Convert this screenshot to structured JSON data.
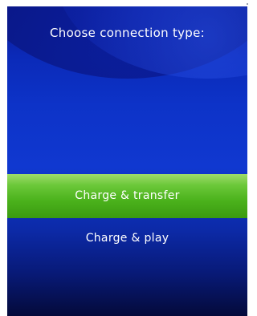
{
  "dialog": {
    "title": "Choose connection type:"
  },
  "options": [
    {
      "label": "Charge & transfer",
      "selected": true
    },
    {
      "label": "Charge & play",
      "selected": false
    }
  ],
  "colors": {
    "background": "#0d33c8",
    "selected_highlight": "#4bb21c",
    "text": "#ffffff"
  }
}
